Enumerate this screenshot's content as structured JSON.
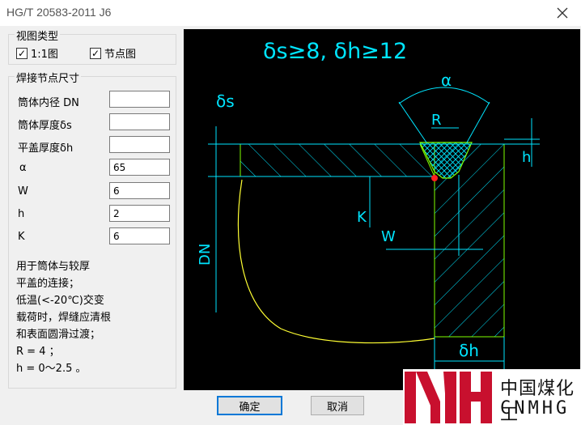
{
  "window": {
    "title": "HG/T 20583-2011 J6"
  },
  "view_group": {
    "title": "视图类型",
    "option_scale": {
      "label": "1:1图",
      "checked": true
    },
    "option_node": {
      "label": "节点图",
      "checked": true
    }
  },
  "dims_group": {
    "title": "焊接节点尺寸",
    "fields": [
      {
        "label": "筒体内径 DN",
        "value": ""
      },
      {
        "label": "筒体厚度δs",
        "value": ""
      },
      {
        "label": "平盖厚度δh",
        "value": ""
      },
      {
        "label": "α",
        "value": "65"
      },
      {
        "label": "W",
        "value": "6"
      },
      {
        "label": "h",
        "value": "2"
      },
      {
        "label": "K",
        "value": "6"
      }
    ],
    "note_lines": [
      "用于筒体与较厚",
      "平盖的连接；",
      "低温(<-20℃)交变",
      "载荷时，焊缝应清根",
      "和表面圆滑过渡；",
      "R = 4 ；",
      "h = 0～2.5 。"
    ]
  },
  "diagram": {
    "heading": "δs≥8, δh≥12",
    "label_alpha": "α",
    "label_R": "R",
    "label_ds": "δs",
    "label_h": "h",
    "label_K": "K",
    "label_W": "W",
    "label_DN": "DN",
    "label_dh": "δh",
    "colors": {
      "cyan": "#00e5ff",
      "green": "#7fff00",
      "yellow": "#ffff33",
      "white": "#ffffff",
      "red": "#ff2020"
    }
  },
  "buttons": {
    "ok": "确定",
    "cancel": "取消"
  },
  "watermark": {
    "text_cn": "中国煤化工",
    "text_en": "CNMHG"
  }
}
